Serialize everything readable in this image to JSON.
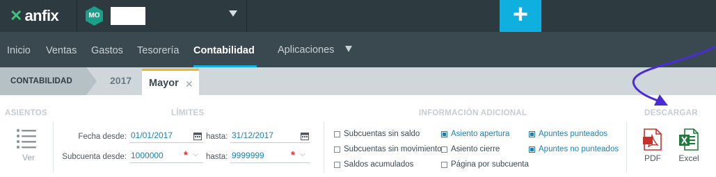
{
  "topbar": {
    "logo_text": "anfix",
    "company_initials": "MO",
    "company_name": "",
    "add_label": "+"
  },
  "nav": {
    "items": [
      {
        "label": "Inicio"
      },
      {
        "label": "Ventas"
      },
      {
        "label": "Gastos"
      },
      {
        "label": "Tesorería"
      },
      {
        "label": "Contabilidad",
        "active": true
      },
      {
        "label": "Aplicaciones"
      }
    ]
  },
  "tabs": {
    "breadcrumb": "CONTABILIDAD",
    "year": "2017",
    "active_tab": "Mayor",
    "close_glyph": "✕"
  },
  "asientos": {
    "title": "ASIENTOS",
    "ver_label": "Ver"
  },
  "limites": {
    "title": "LÍMITES",
    "fecha_desde_label": "Fecha desde:",
    "fecha_desde_value": "01/01/2017",
    "fecha_hasta_label": "hasta:",
    "fecha_hasta_value": "31/12/2017",
    "subcuenta_desde_label": "Subcuenta desde:",
    "subcuenta_desde_value": "1000000",
    "subcuenta_hasta_label": "hasta:",
    "subcuenta_hasta_value": "9999999",
    "required_mark": "*",
    "chevron": "⌵"
  },
  "info": {
    "title": "INFORMACIÓN ADICIONAL",
    "options": [
      {
        "label": "Subcuentas sin saldo",
        "checked": false
      },
      {
        "label": "Subcuentas sin movimiento",
        "checked": false
      },
      {
        "label": "Saldos acumulados",
        "checked": false
      },
      {
        "label": "Asiento apertura",
        "checked": true
      },
      {
        "label": "Asiento cierre",
        "checked": false
      },
      {
        "label": "Página por subcuenta",
        "checked": false
      },
      {
        "label": "Apuntes punteados",
        "checked": true
      },
      {
        "label": "Apuntes no punteados",
        "checked": true
      }
    ]
  },
  "descargar": {
    "title": "DESCARGAR",
    "pdf_label": "PDF",
    "excel_label": "Excel"
  },
  "colors": {
    "topbar": "#2d3a40",
    "navbar": "#3a4950",
    "accent": "#0fb0e0",
    "tab_highlight": "#f0b429",
    "link_blue": "#1c7fb3",
    "annotation_arrow": "#4a2bd8"
  }
}
